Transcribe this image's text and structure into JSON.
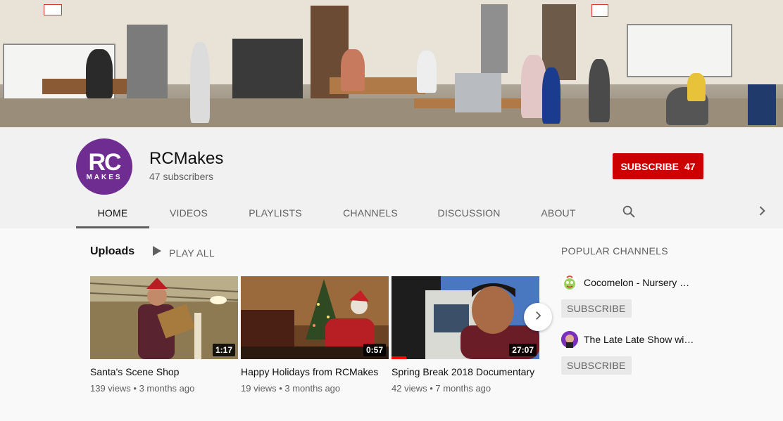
{
  "channel": {
    "name": "RCMakes",
    "subscribers": "47 subscribers",
    "avatar_text": "RC",
    "avatar_subtext": "MAKES",
    "subscribe_label": "SUBSCRIBE",
    "subscribe_count": "47",
    "colors": {
      "brand": "#6f2c91",
      "subscribe": "#cc0000"
    }
  },
  "tabs": [
    {
      "label": "HOME",
      "active": true
    },
    {
      "label": "VIDEOS"
    },
    {
      "label": "PLAYLISTS"
    },
    {
      "label": "CHANNELS"
    },
    {
      "label": "DISCUSSION"
    },
    {
      "label": "ABOUT"
    }
  ],
  "icons": {
    "search": "search-icon",
    "scroll_right": "chevron-right-icon",
    "play": "play-icon",
    "next": "chevron-right-icon"
  },
  "uploads": {
    "title": "Uploads",
    "play_all": "PLAY ALL",
    "videos": [
      {
        "title": "Santa's Scene Shop",
        "meta": "139 views • 3 months ago",
        "duration": "1:17"
      },
      {
        "title": "Happy Holidays from RCMakes",
        "meta": "19 views • 3 months ago",
        "duration": "0:57"
      },
      {
        "title": "Spring Break 2018 Documentary",
        "meta": "42 views • 7 months ago",
        "duration": "27:07",
        "watched_fraction": 0.1
      }
    ]
  },
  "popular": {
    "title": "POPULAR CHANNELS",
    "channels": [
      {
        "name": "Cocomelon - Nursery Rhymes",
        "subscribe_label": "SUBSCRIBE"
      },
      {
        "name": "The Late Late Show with James Corden",
        "subscribe_label": "SUBSCRIBE"
      }
    ]
  }
}
